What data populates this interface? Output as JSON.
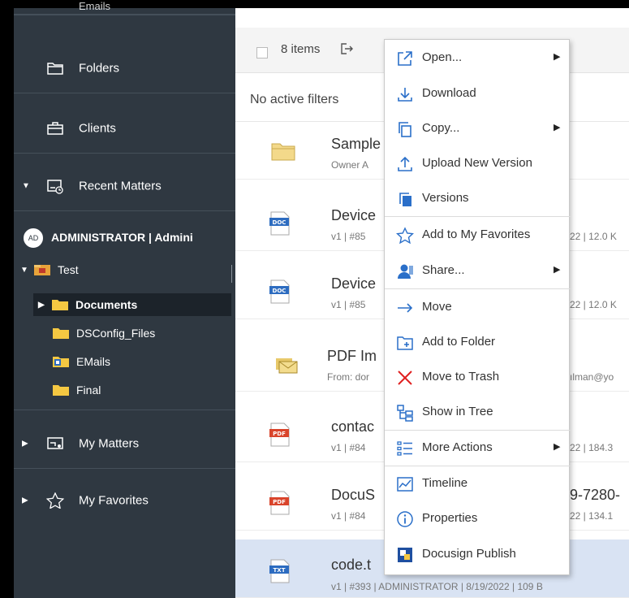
{
  "sidebar": {
    "partial_top_label": "Emails",
    "items": [
      {
        "label": "Folders",
        "icon": "folder-icon"
      },
      {
        "label": "Clients",
        "icon": "briefcase-icon"
      },
      {
        "label": "Recent Matters",
        "icon": "recent-matters-icon"
      },
      {
        "label": "My Matters",
        "icon": "my-matters-icon"
      },
      {
        "label": "My Favorites",
        "icon": "star-icon"
      }
    ],
    "user": {
      "initials": "AD",
      "name": "ADMINISTRATOR | Admini"
    },
    "tree": {
      "root": "Test",
      "children": [
        "Documents",
        "DSConfig_Files",
        "EMails",
        "Final"
      ]
    }
  },
  "main": {
    "items_count": "8 items",
    "filters": "No active filters",
    "rows": [
      {
        "type": "folder",
        "name": "Sample",
        "meta": "Owner A",
        "meta_right": "",
        "name_right": ""
      },
      {
        "type": "doc",
        "badge": "DOC",
        "name": "Device",
        "meta": "v1 | #85",
        "meta_right": "22 | 12.0 K",
        "name_right": ""
      },
      {
        "type": "doc",
        "badge": "DOC",
        "name": "Device",
        "meta": "v1 | #85",
        "meta_right": "22 | 12.0 K",
        "name_right": ""
      },
      {
        "type": "email",
        "name": "PDF Im",
        "meta": "From: dor",
        "meta_right": "ılman@yo",
        "name_right": ""
      },
      {
        "type": "pdf",
        "badge": "PDF",
        "name": "contac",
        "meta": "v1 | #84",
        "meta_right": "22 | 184.3",
        "name_right": ""
      },
      {
        "type": "pdf",
        "badge": "PDF",
        "name": "DocuS",
        "meta": "v1 | #84",
        "meta_right": "22 | 134.1",
        "name_right": "9-7280-"
      },
      {
        "type": "txt",
        "badge": "TXT",
        "name": "code.t",
        "meta": "v1 | #393 | ADMINISTRATOR | 8/19/2022 | 109 B",
        "meta_right": "",
        "name_right": ""
      }
    ]
  },
  "context_menu": {
    "items": [
      {
        "label": "Open...",
        "icon": "open-external-icon",
        "submenu": true
      },
      {
        "label": "Download",
        "icon": "download-icon",
        "submenu": false
      },
      {
        "label": "Copy...",
        "icon": "copy-icon",
        "submenu": true
      },
      {
        "label": "Upload New Version",
        "icon": "upload-icon",
        "submenu": false
      },
      {
        "label": "Versions",
        "icon": "versions-icon",
        "submenu": false
      },
      {
        "label": "Add to My Favorites",
        "icon": "star-icon",
        "submenu": false
      },
      {
        "label": "Share...",
        "icon": "share-user-icon",
        "submenu": true
      },
      {
        "label": "Move",
        "icon": "move-arrow-icon",
        "submenu": false
      },
      {
        "label": "Add to Folder",
        "icon": "add-to-folder-icon",
        "submenu": false
      },
      {
        "label": "Move to Trash",
        "icon": "trash-x-icon",
        "submenu": false
      },
      {
        "label": "Show in Tree",
        "icon": "tree-icon",
        "submenu": false
      },
      {
        "label": "More Actions",
        "icon": "list-icon",
        "submenu": true
      },
      {
        "label": "Timeline",
        "icon": "timeline-icon",
        "submenu": false
      },
      {
        "label": "Properties",
        "icon": "info-icon",
        "submenu": false
      },
      {
        "label": "Docusign Publish",
        "icon": "docusign-icon",
        "submenu": false
      }
    ],
    "submenu_arrow": "▶"
  },
  "colors": {
    "sidebar_bg": "#2f3841",
    "selected_row": "#d9e3f3",
    "accent_blue": "#2a6fc9",
    "trash_red": "#e02020",
    "pdf_red": "#d9442b",
    "doc_blue": "#2d6cc0",
    "folder_yellow": "#f3d98a"
  }
}
